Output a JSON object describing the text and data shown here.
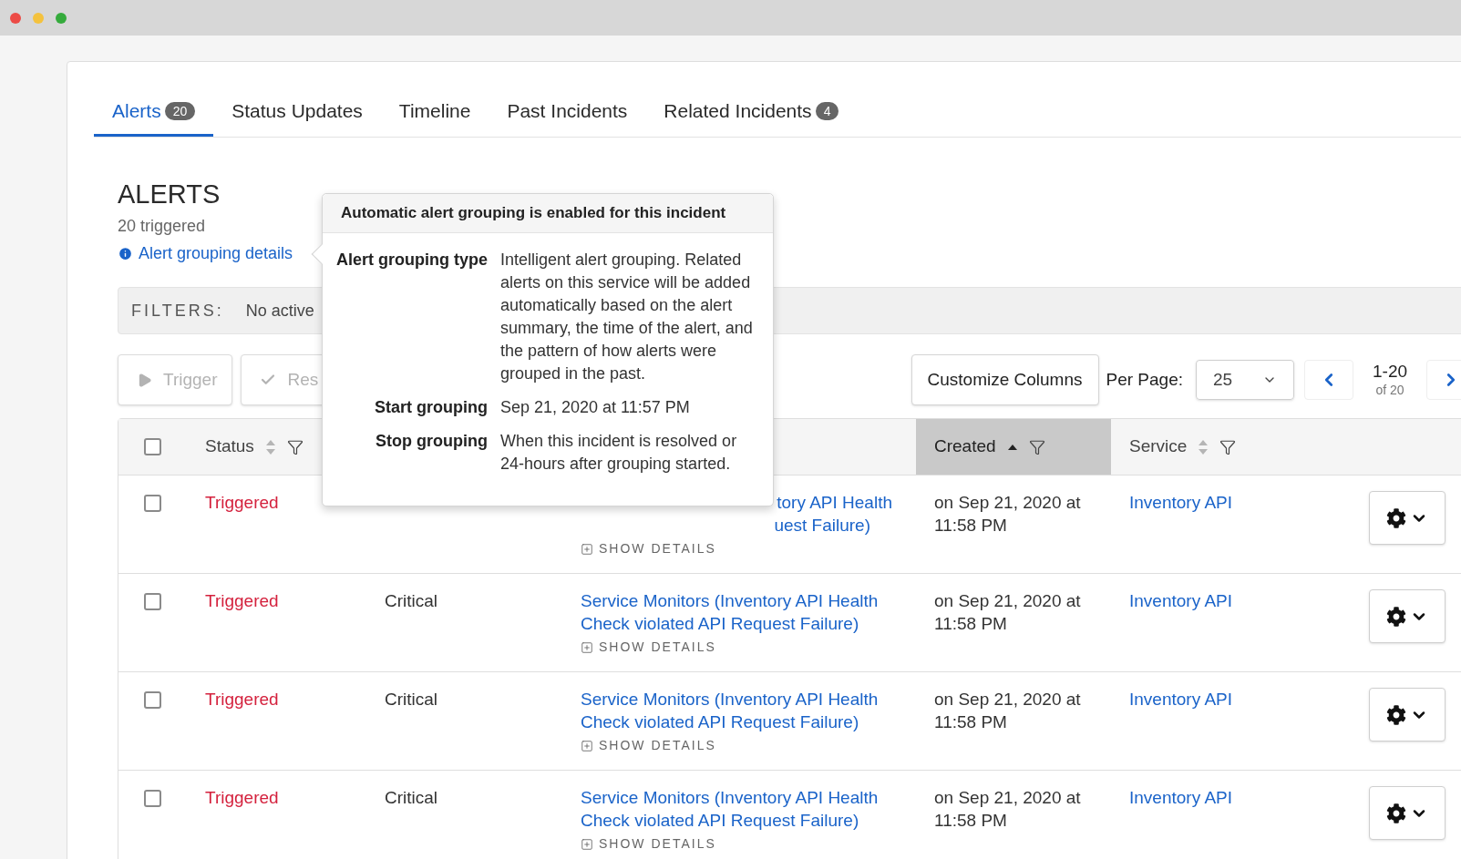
{
  "window": {
    "controls": [
      {
        "color": "#ec4b46"
      },
      {
        "color": "#f4c23e"
      },
      {
        "color": "#35ab3c"
      }
    ]
  },
  "tabs": [
    {
      "label": "Alerts",
      "count": "20",
      "selected": true
    },
    {
      "label": "Status Updates",
      "selected": false
    },
    {
      "label": "Timeline",
      "selected": false
    },
    {
      "label": "Past Incidents",
      "selected": false
    },
    {
      "label": "Related Incidents",
      "count": "4",
      "selected": false
    }
  ],
  "section": {
    "title": "ALERTS",
    "subtitle": "20 triggered",
    "details_link": "Alert grouping details"
  },
  "filters": {
    "label": "FILTERS:",
    "text": "No active"
  },
  "actions": [
    {
      "label": "Trigger",
      "disabled": true
    },
    {
      "label": "Res",
      "disabled": true
    }
  ],
  "toolbar": {
    "customize": "Customize Columns",
    "per_page_label": "Per Page:",
    "per_page": "25",
    "range": "1-20",
    "total": "of 20"
  },
  "table": {
    "select_all_checked": false,
    "columns": [
      {
        "label": "Status",
        "sorted": false,
        "selected": false
      },
      {
        "label": "Created",
        "sorted": true,
        "selected": true
      },
      {
        "label": "Service",
        "sorted": false,
        "selected": false
      }
    ],
    "rows": [
      {
        "checked": false,
        "status": "Triggered",
        "title_lines": [
          "tory API Health",
          "uest Failure)"
        ],
        "show_details": "SHOW DETAILS",
        "created": "on Sep 21, 2020 at 11:58 PM",
        "service": "Inventory API"
      },
      {
        "checked": false,
        "status": "Triggered",
        "urgency": "Critical",
        "title_lines": [
          "Service Monitors (Inventory API Health",
          "Check violated API Request Failure)"
        ],
        "show_details": "SHOW DETAILS",
        "created": "on Sep 21, 2020 at 11:58 PM",
        "service": "Inventory API"
      },
      {
        "checked": false,
        "status": "Triggered",
        "urgency": "Critical",
        "title_lines": [
          "Service Monitors (Inventory API Health",
          "Check violated API Request Failure)"
        ],
        "show_details": "SHOW DETAILS",
        "created": "on Sep 21, 2020 at 11:58 PM",
        "service": "Inventory API"
      },
      {
        "checked": false,
        "status": "Triggered",
        "urgency": "Critical",
        "title_lines": [
          "Service Monitors (Inventory API Health",
          "Check violated API Request Failure)"
        ],
        "show_details": "SHOW DETAILS",
        "created": "on Sep 21, 2020 at 11:58 PM",
        "service": "Inventory API"
      }
    ]
  },
  "tooltip": {
    "heading": "Automatic alert grouping is enabled for this incident",
    "rows": [
      {
        "label": "Alert grouping type",
        "value": "Intelligent alert grouping. Related alerts on this service will be added automatically based on the alert summary, the time of the alert, and the pattern of how alerts were grouped in the past."
      },
      {
        "label": "Start grouping",
        "value": "Sep 21, 2020 at 11:57 PM"
      },
      {
        "label": "Stop grouping",
        "value": "When this incident is resolved or 24-hours after grouping started."
      }
    ]
  }
}
